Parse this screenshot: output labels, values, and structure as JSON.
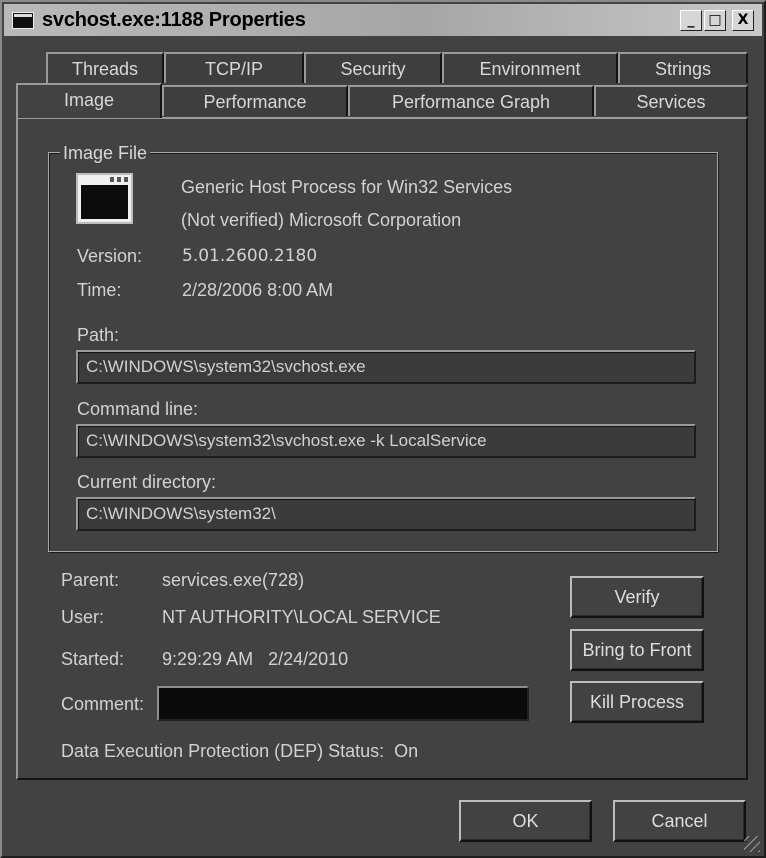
{
  "window": {
    "title": "svchost.exe:1188 Properties",
    "controls": {
      "minimize": "_",
      "maximize": "□",
      "close": "X"
    }
  },
  "tabs": {
    "row1": [
      "Threads",
      "TCP/IP",
      "Security",
      "Environment",
      "Strings"
    ],
    "row2": [
      "Image",
      "Performance",
      "Performance Graph",
      "Services"
    ],
    "active": "Image"
  },
  "image_file": {
    "legend": "Image File",
    "icon": "window-app-icon",
    "description": "Generic Host Process for Win32 Services",
    "company": "(Not verified) Microsoft Corporation",
    "version_label": "Version:",
    "version": "5.01.2600.2180",
    "time_label": "Time:",
    "time": "2/28/2006 8:00 AM",
    "path_label": "Path:",
    "path": "C:\\WINDOWS\\system32\\svchost.exe",
    "cmdline_label": "Command line:",
    "cmdline": "C:\\WINDOWS\\system32\\svchost.exe -k LocalService",
    "curdir_label": "Current directory:",
    "curdir": "C:\\WINDOWS\\system32\\"
  },
  "process": {
    "parent_label": "Parent:",
    "parent": "services.exe(728)",
    "user_label": "User:",
    "user": "NT AUTHORITY\\LOCAL SERVICE",
    "started_label": "Started:",
    "started": "9:29:29 AM   2/24/2010",
    "comment_label": "Comment:",
    "comment": "",
    "dep": "Data Execution Protection (DEP) Status:  On"
  },
  "buttons": {
    "verify": "Verify",
    "bring_to_front": "Bring to Front",
    "kill_process": "Kill Process",
    "ok": "OK",
    "cancel": "Cancel"
  },
  "colors": {
    "window_bg": "#424242",
    "titlebar": "#b0b0b0",
    "text": "#d2d2d2"
  }
}
